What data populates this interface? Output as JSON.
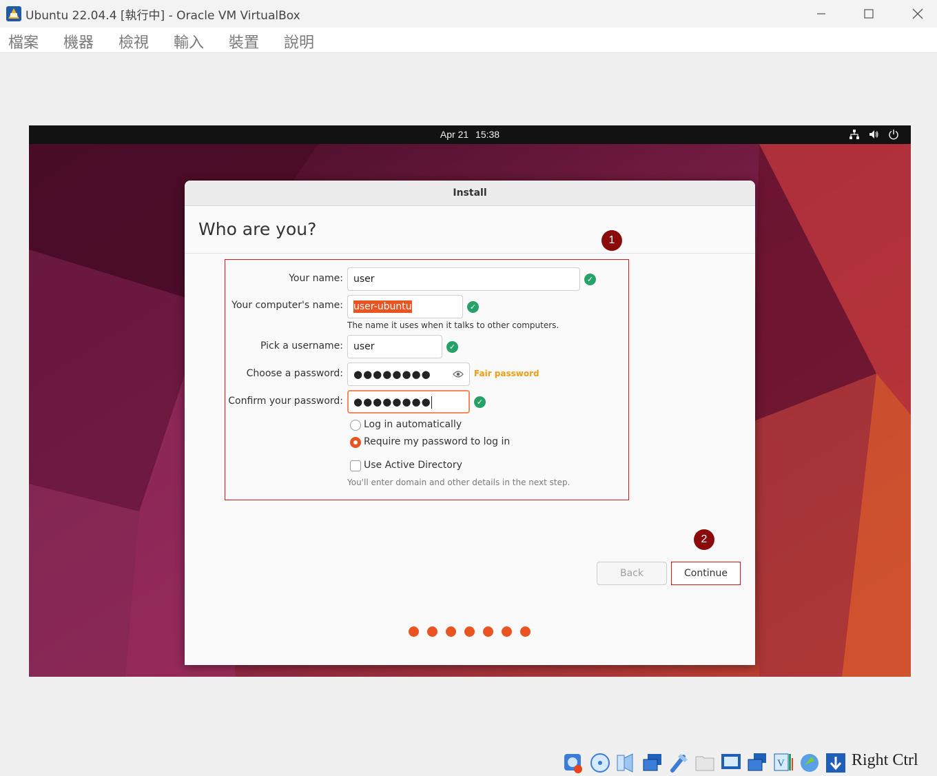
{
  "window": {
    "title": "Ubuntu 22.04.4 [執行中] - Oracle VM VirtualBox",
    "app_icon": "virtualbox-icon",
    "controls": [
      "minimize-icon",
      "maximize-icon",
      "close-icon"
    ]
  },
  "menubar": {
    "items": [
      "檔案",
      "機器",
      "檢視",
      "輸入",
      "裝置",
      "說明"
    ]
  },
  "vm_topbar": {
    "date": "Apr 21",
    "time": "15:38",
    "tray_icons": [
      "network-icon",
      "volume-icon",
      "power-icon"
    ]
  },
  "dialog": {
    "title": "Install",
    "heading": "Who are you?",
    "form": {
      "name_label": "Your name:",
      "name_value": "user",
      "computer_label": "Your computer's name:",
      "computer_value": "user-ubuntu",
      "computer_hint": "The name it uses when it talks to other computers.",
      "username_label": "Pick a username:",
      "username_value": "user",
      "password_label": "Choose a password:",
      "password_value": "●●●●●●●●",
      "password_strength": "Fair password",
      "confirm_label": "Confirm your password:",
      "confirm_value": "●●●●●●●●",
      "login_auto_label": "Log in automatically",
      "login_require_label": "Require my password to log in",
      "login_selected": "require",
      "ad_label": "Use Active Directory",
      "ad_checked": false,
      "ad_hint": "You'll enter domain and other details in the next step."
    },
    "buttons": {
      "back": "Back",
      "continue": "Continue"
    },
    "progress": {
      "steps_total": 7,
      "steps_done": 7
    }
  },
  "annotations": [
    "1",
    "2"
  ],
  "statusbar": {
    "icons": [
      "harddisk-icon",
      "optical-disk-icon",
      "audio-icon",
      "network-adapter-icon",
      "usb-icon",
      "shared-folder-icon",
      "display-icon",
      "snapshot-icon",
      "vt-x-icon",
      "mouse-integration-icon",
      "keyboard-capture-icon"
    ],
    "host_key": "Right Ctrl"
  },
  "colors": {
    "ubuntu_orange": "#e95420",
    "ok_green": "#26a269",
    "annotation_red": "#d11a1a",
    "annotation_badge": "#8b0a0a",
    "strength_amber": "#f39c12"
  }
}
